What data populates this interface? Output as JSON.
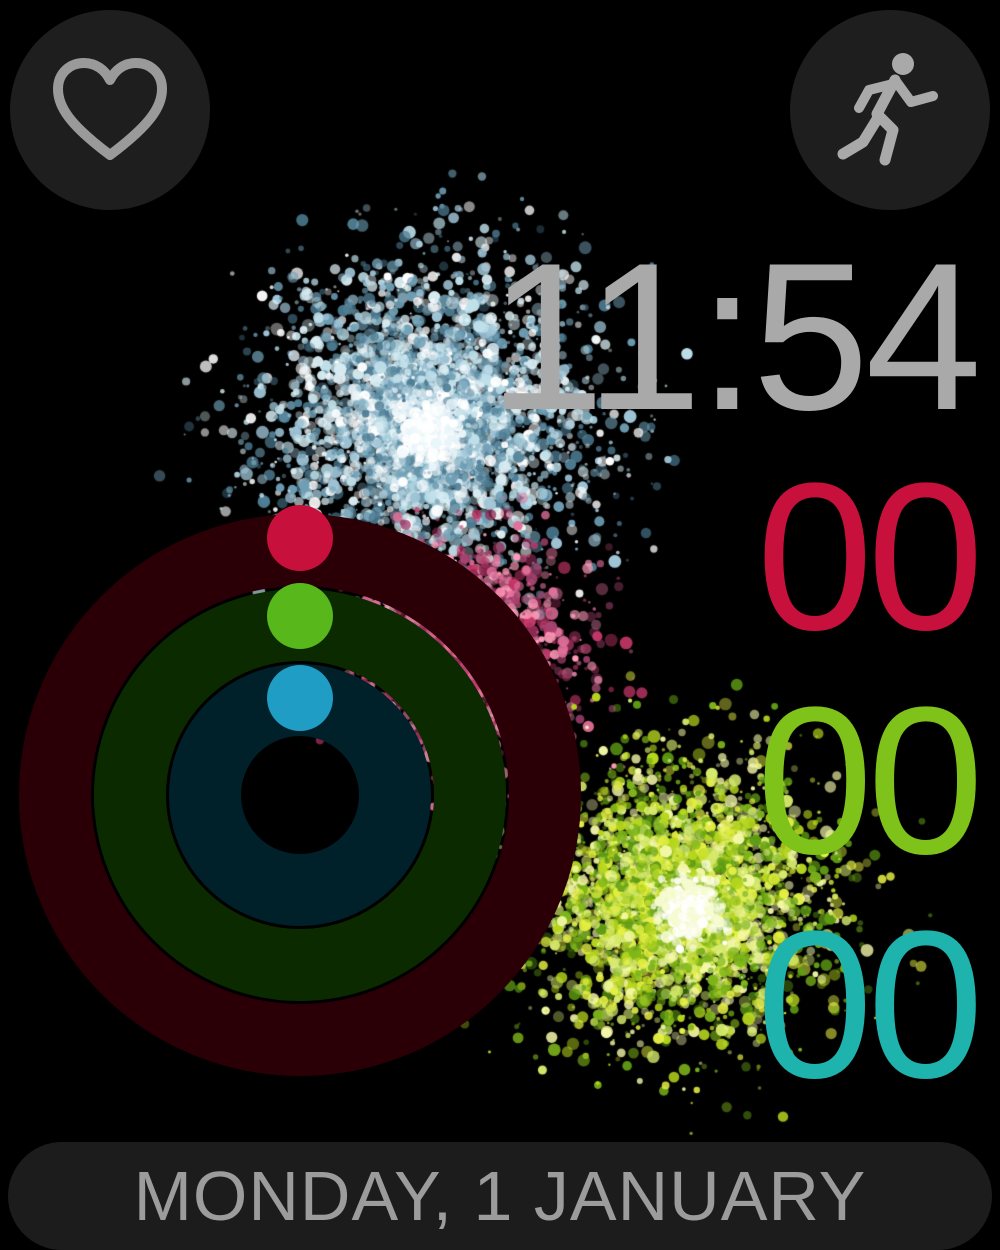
{
  "clock": {
    "time": "11:54"
  },
  "activity": {
    "move_value": "00",
    "exercise_value": "00",
    "stand_value": "00",
    "move_progress": 0,
    "exercise_progress": 0,
    "stand_progress": 0
  },
  "date": {
    "label": "MONDAY, 1 JANUARY"
  },
  "complications": {
    "left_icon": "heart-icon",
    "right_icon": "running-figure-icon"
  },
  "colors": {
    "background": "#000000",
    "time": "#a9a9a9",
    "move": "#c8103c",
    "exercise": "#7fc21a",
    "stand": "#1fb3ad",
    "move_track": "#2a0006",
    "exercise_track": "#0c2a00",
    "stand_track": "#00202a",
    "complication_bg": "#1e1e1e",
    "date_text": "#9c9c9c"
  }
}
